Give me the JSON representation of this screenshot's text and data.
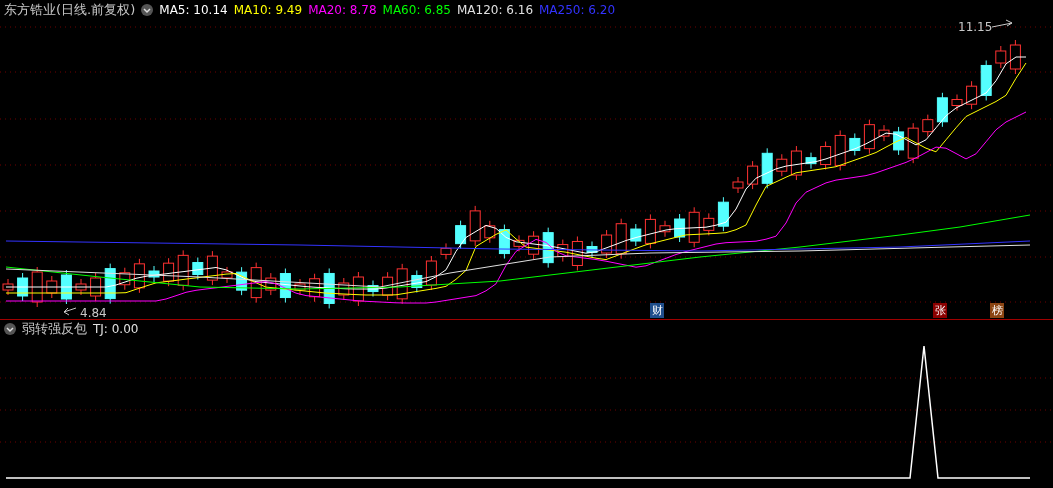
{
  "header": {
    "title": "东方锆业(日线.前复权)",
    "indicators": [
      {
        "label": "MA5: 10.14",
        "color": "#ffffff"
      },
      {
        "label": "MA10: 9.49",
        "color": "#ffff00"
      },
      {
        "label": "MA20: 8.78",
        "color": "#ff00ff"
      },
      {
        "label": "MA60: 6.85",
        "color": "#00ff00"
      },
      {
        "label": "MA120: 6.16",
        "color": "#e0e0e0"
      },
      {
        "label": "MA250: 6.20",
        "color": "#3333ff"
      }
    ]
  },
  "main_chart": {
    "high_label": "11.15",
    "low_label": "4.84",
    "markers": [
      {
        "text": "财",
        "color": "#1f4e8c"
      },
      {
        "text": "张",
        "color": "#8b0000"
      },
      {
        "text": "榜",
        "color": "#8b4513"
      }
    ]
  },
  "sub_panel": {
    "title": "弱转强反包",
    "indicators": [
      {
        "label": "TJ: 0.00",
        "color": "#e0e0e0"
      }
    ]
  }
}
